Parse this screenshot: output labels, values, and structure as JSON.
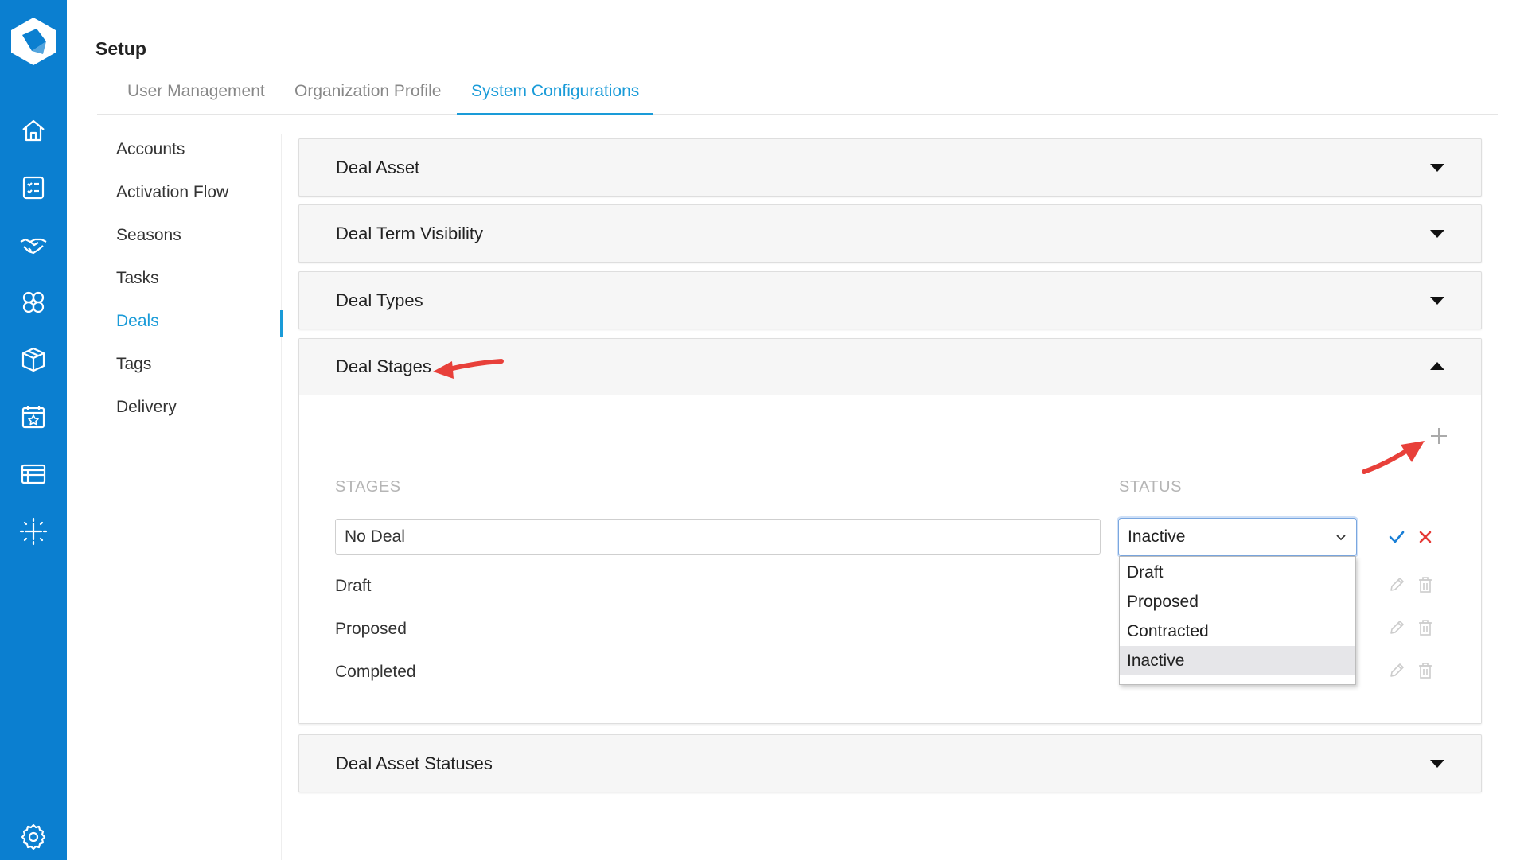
{
  "page": {
    "title": "Setup"
  },
  "tabs": [
    {
      "label": "User Management",
      "active": false
    },
    {
      "label": "Organization Profile",
      "active": false
    },
    {
      "label": "System Configurations",
      "active": true
    }
  ],
  "side_menu": [
    {
      "label": "Accounts"
    },
    {
      "label": "Activation Flow"
    },
    {
      "label": "Seasons"
    },
    {
      "label": "Tasks"
    },
    {
      "label": "Deals",
      "active": true
    },
    {
      "label": "Tags"
    },
    {
      "label": "Delivery"
    }
  ],
  "panels": {
    "deal_asset": {
      "title": "Deal Asset",
      "expanded": false
    },
    "deal_term_visibility": {
      "title": "Deal Term Visibility",
      "expanded": false
    },
    "deal_types": {
      "title": "Deal Types",
      "expanded": false
    },
    "deal_stages": {
      "title": "Deal Stages",
      "expanded": true,
      "columns": {
        "stages": "STAGES",
        "status": "STATUS"
      },
      "edit_row": {
        "stage_value": "No Deal",
        "status_selected": "Inactive",
        "status_options": [
          "Draft",
          "Proposed",
          "Contracted",
          "Inactive"
        ]
      },
      "rows": [
        {
          "stage": "Draft"
        },
        {
          "stage": "Proposed"
        },
        {
          "stage": "Completed"
        }
      ]
    },
    "deal_asset_statuses": {
      "title": "Deal Asset Statuses",
      "expanded": false
    }
  },
  "colors": {
    "rail": "#0b7fd0",
    "accent": "#1a9bd8",
    "confirm": "#1a7fd6",
    "cancel": "#e53935",
    "annotation": "#e8403a"
  },
  "icons": [
    "logo-icon",
    "home-icon",
    "checklist-icon",
    "handshake-icon",
    "partners-icon",
    "box-icon",
    "calendar-icon",
    "table-icon",
    "sparkle-icon",
    "settings-icon",
    "plus-icon",
    "check-icon",
    "close-icon",
    "pencil-icon",
    "trash-icon",
    "chevron-down-icon",
    "caret-down-icon",
    "caret-up-icon"
  ]
}
